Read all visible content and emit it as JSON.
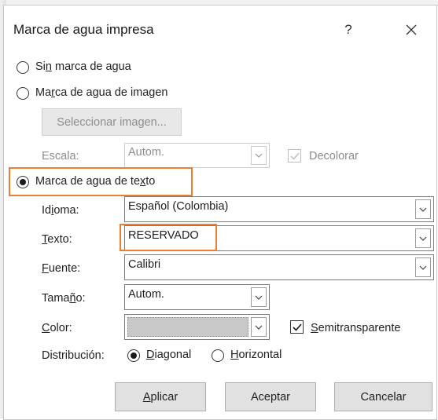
{
  "dialog": {
    "title": "Marca de agua impresa",
    "help": "?"
  },
  "options": {
    "none": {
      "pre": "Si",
      "key": "n",
      "post": " marca de agua"
    },
    "picture": {
      "pre": "Ma",
      "key": "r",
      "post": "ca de agua de imagen"
    },
    "text": {
      "pre": "Marca de agua de te",
      "key": "x",
      "post": "to"
    }
  },
  "picture": {
    "select_button": "Seleccionar imagen...",
    "scale_label": "Escala:",
    "scale_value": "Autom.",
    "washout_label": "Decolorar"
  },
  "text": {
    "language_label": {
      "pre": "Id",
      "key": "i",
      "post": "oma:"
    },
    "language_value": "Español (Colombia)",
    "text_label": {
      "pre": "",
      "key": "T",
      "post": "exto:"
    },
    "text_value": "RESERVADO",
    "font_label": {
      "pre": "",
      "key": "F",
      "post": "uente:"
    },
    "font_value": "Calibri",
    "size_label": {
      "pre": "Tama",
      "key": "ñ",
      "post": "o:"
    },
    "size_value": "Autom.",
    "color_label": {
      "pre": "",
      "key": "C",
      "post": "olor:"
    },
    "semitransparent_label": {
      "pre": "",
      "key": "S",
      "post": "emitransparente"
    },
    "layout_label": "Distribución:",
    "diagonal_label": {
      "pre": "",
      "key": "D",
      "post": "iagonal"
    },
    "horizontal_label": {
      "pre": "",
      "key": "H",
      "post": "orizontal"
    }
  },
  "buttons": {
    "apply": {
      "pre": "",
      "key": "A",
      "post": "plicar"
    },
    "ok": "Aceptar",
    "cancel": "Cancelar"
  },
  "colors": {
    "highlight": "#ed7d31",
    "color_swatch": "#c8c8c8"
  }
}
